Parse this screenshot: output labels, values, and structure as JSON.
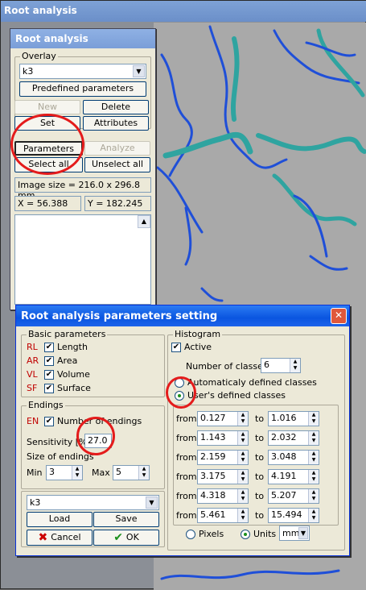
{
  "app": {
    "title": "Root analysis"
  },
  "tool": {
    "title": "Root analysis",
    "overlay_label": "Overlay",
    "overlay_value": "k3",
    "predefined_label": "Predefined parameters",
    "new_label": "New",
    "delete_label": "Delete",
    "set_label": "Set",
    "attributes_label": "Attributes",
    "parameters_label": "Parameters",
    "analyze_label": "Analyze",
    "select_all_label": "Select all",
    "unselect_all_label": "Unselect all",
    "image_size": "Image size = 216.0 x 296.8 mm",
    "x_readout": "X = 56.388",
    "y_readout": "Y = 182.245"
  },
  "dialog": {
    "title": "Root analysis parameters setting",
    "basic_label": "Basic parameters",
    "basic": [
      {
        "code": "RL",
        "label": "Length",
        "checked": true
      },
      {
        "code": "AR",
        "label": "Area",
        "checked": true
      },
      {
        "code": "VL",
        "label": "Volume",
        "checked": true
      },
      {
        "code": "SF",
        "label": "Surface",
        "checked": true
      }
    ],
    "endings_label": "Endings",
    "endings_code": "EN",
    "endings_check_label": "Number of endings",
    "sensitivity_label": "Sensitivity [%]",
    "sensitivity_value": "27.0",
    "size_label": "Size of endings",
    "min_label": "Min",
    "min_value": "3",
    "max_label": "Max",
    "max_value": "5",
    "overlay_value": "k3",
    "load_label": "Load",
    "save_label": "Save",
    "cancel_label": "Cancel",
    "ok_label": "OK",
    "histogram_label": "Histogram",
    "active_label": "Active",
    "num_classes_label": "Number of classes",
    "num_classes_value": "6",
    "auto_label": "Automaticaly defined classes",
    "user_label": "User's defined classes",
    "from_label": "from",
    "to_label": "to",
    "classes": [
      {
        "from": "0.127",
        "to": "1.016"
      },
      {
        "from": "1.143",
        "to": "2.032"
      },
      {
        "from": "2.159",
        "to": "3.048"
      },
      {
        "from": "3.175",
        "to": "4.191"
      },
      {
        "from": "4.318",
        "to": "5.207"
      },
      {
        "from": "5.461",
        "to": "15.494"
      }
    ],
    "pixels_label": "Pixels",
    "units_label": "Units",
    "units_value": "mm"
  },
  "colors": {
    "root_blue": "#1f4fd8",
    "root_teal": "#2fa4a0",
    "highlight_red": "#e41b1b"
  }
}
